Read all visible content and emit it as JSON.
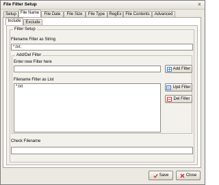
{
  "window": {
    "title": "File Filter Setup",
    "close_glyph": "×"
  },
  "tabs": [
    {
      "label": "Setup"
    },
    {
      "label": "File Name"
    },
    {
      "label": "File Date"
    },
    {
      "label": "File Size"
    },
    {
      "label": "File Type"
    },
    {
      "label": "RegEx"
    },
    {
      "label": "File Contents"
    },
    {
      "label": "Advanced"
    }
  ],
  "active_tab": "File Name",
  "subtabs": [
    {
      "label": "Include"
    },
    {
      "label": "Exclude"
    }
  ],
  "active_subtab": "Include",
  "filter_setup": {
    "group_label": "Filter Setup",
    "filter_string_label": "Filename Filter as String",
    "filter_string_value": "*.txt;"
  },
  "add_del": {
    "group_label": "Add/Del Filter",
    "new_filter_label": "Enter new Filter here",
    "new_filter_value": "",
    "add_button": "Add Filter",
    "list_label": "Filename Filter as List",
    "list_items": [
      "*.txt"
    ],
    "upd_button": "Upd Filter",
    "del_button": "Del Filter"
  },
  "check": {
    "label": "Check Filename",
    "value": ""
  },
  "footer": {
    "save_button": "Save",
    "close_button": "Close"
  },
  "colors": {
    "add_icon": "#3f7fcf",
    "upd_icon": "#3f7fcf",
    "del_icon": "#d23c3c",
    "save_icon": "#d9372b",
    "close_icon": "#c0272d"
  }
}
